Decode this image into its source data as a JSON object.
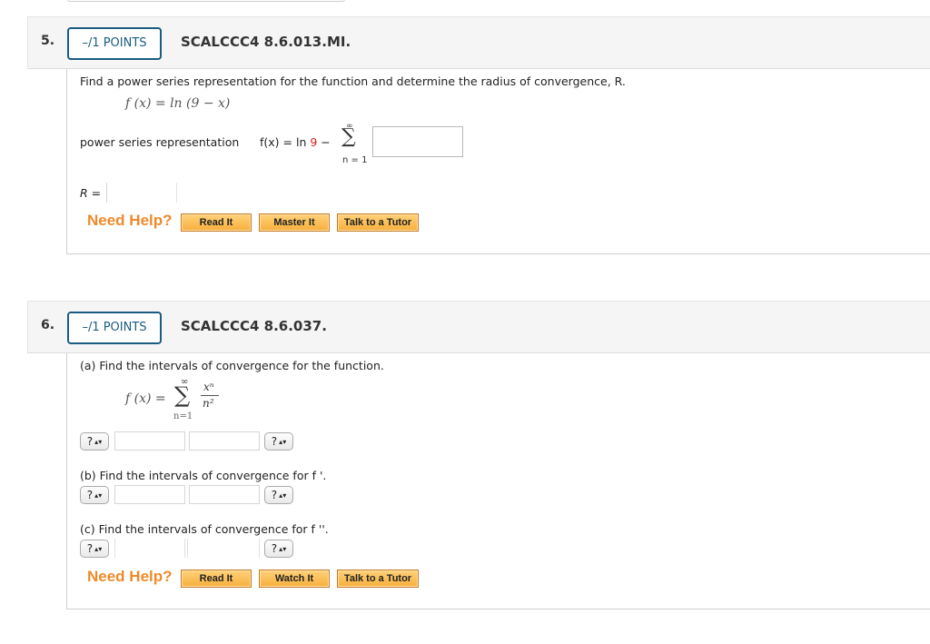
{
  "questions": [
    {
      "number": "5.",
      "points": "–/1 POINTS",
      "code": "SCALCCC4 8.6.013.MI.",
      "prompt": "Find a power series representation for the function and determine the radius of convergence, R.",
      "function_display": "f (x) = ln (9 − x)",
      "power_series_label": "power series representation",
      "series_prefix": "f(x) = ln ",
      "series_red_value": "9",
      "series_minus": " −",
      "sum_upper": "∞",
      "sum_symbol": "∑",
      "sum_lower": "n = 1",
      "series_term_value": "",
      "radius_label": "R =",
      "radius_value": "",
      "need_help": "Need Help?",
      "help_buttons": [
        "Read It",
        "Master It",
        "Talk to a Tutor"
      ]
    },
    {
      "number": "6.",
      "points": "–/1 POINTS",
      "code": "SCALCCC4 8.6.037.",
      "part_a": "(a) Find the intervals of convergence for the function.",
      "function_lhs": "f (x) =",
      "sum_upper": "∞",
      "sum_symbol": "∑",
      "sum_lower": "n=1",
      "frac_num": "xⁿ",
      "frac_den": "n²",
      "part_b": "(b) Find the intervals of convergence for f '.",
      "part_c": "(c) Find the intervals of convergence for f ''.",
      "select_placeholder": "?",
      "interval_inputs": [
        {
          "left_bracket": "?",
          "lower": "",
          "upper": "",
          "right_bracket": "?"
        },
        {
          "left_bracket": "?",
          "lower": "",
          "upper": "",
          "right_bracket": "?"
        },
        {
          "left_bracket": "?",
          "lower": "",
          "upper": "",
          "right_bracket": "?"
        }
      ],
      "need_help": "Need Help?",
      "help_buttons": [
        "Read It",
        "Watch It",
        "Talk to a Tutor"
      ]
    }
  ]
}
